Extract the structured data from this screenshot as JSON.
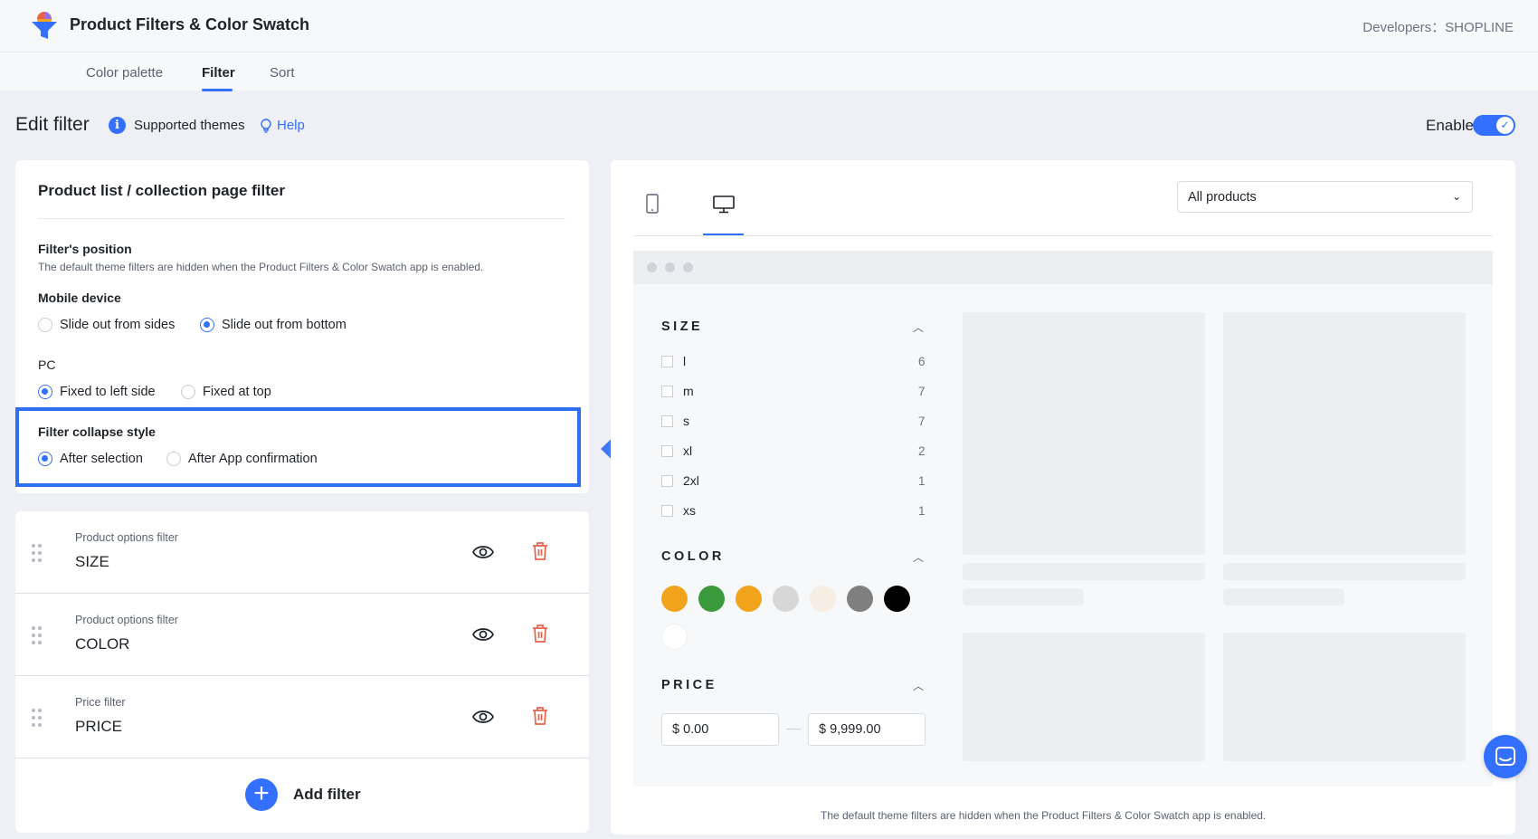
{
  "app": {
    "title": "Product Filters & Color Swatch",
    "developers": "Developers：SHOPLINE"
  },
  "tabs": [
    {
      "label": "Color palette",
      "active": false
    },
    {
      "label": "Filter",
      "active": true
    },
    {
      "label": "Sort",
      "active": false
    }
  ],
  "page": {
    "title": "Edit filter",
    "supported_themes": "Supported themes",
    "help": "Help",
    "enable_label": "Enable",
    "enabled": true
  },
  "settings": {
    "card_title": "Product list / collection page filter",
    "position_label": "Filter's position",
    "position_note": "The default theme filters are hidden when the Product Filters & Color Swatch app is enabled.",
    "mobile_label": "Mobile device",
    "mobile_options": [
      {
        "label": "Slide out from sides",
        "selected": false
      },
      {
        "label": "Slide out from bottom",
        "selected": true
      }
    ],
    "pc_label": "PC",
    "pc_options": [
      {
        "label": "Fixed to left side",
        "selected": true
      },
      {
        "label": "Fixed at top",
        "selected": false
      }
    ],
    "collapse_label": "Filter collapse style",
    "collapse_options": [
      {
        "label": "After selection",
        "selected": true
      },
      {
        "label": "After App confirmation",
        "selected": false
      }
    ]
  },
  "filters": [
    {
      "type": "Product options filter",
      "name": "SIZE"
    },
    {
      "type": "Product options filter",
      "name": "COLOR"
    },
    {
      "type": "Price filter",
      "name": "PRICE"
    }
  ],
  "add_filter_label": "Add filter",
  "preview": {
    "select_value": "All products",
    "size_title": "SIZE",
    "size_options": [
      {
        "label": "l",
        "count": "6"
      },
      {
        "label": "m",
        "count": "7"
      },
      {
        "label": "s",
        "count": "7"
      },
      {
        "label": "xl",
        "count": "2"
      },
      {
        "label": "2xl",
        "count": "1"
      },
      {
        "label": "xs",
        "count": "1"
      }
    ],
    "color_title": "COLOR",
    "colors": [
      "#f2a31c",
      "#3b9a3b",
      "#f2a31c",
      "#d7d7d7",
      "#f6eee4",
      "#7f7f7f",
      "#000000",
      "#ffffff"
    ],
    "price_title": "PRICE",
    "price_min": "$ 0.00",
    "price_max": "$ 9,999.00",
    "footer_note": "The default theme filters are hidden when the Product Filters & Color Swatch app is enabled."
  },
  "colors": {
    "accent": "#3370ff",
    "highlight_border": "#2e6ff2",
    "delete": "#e8624a"
  }
}
